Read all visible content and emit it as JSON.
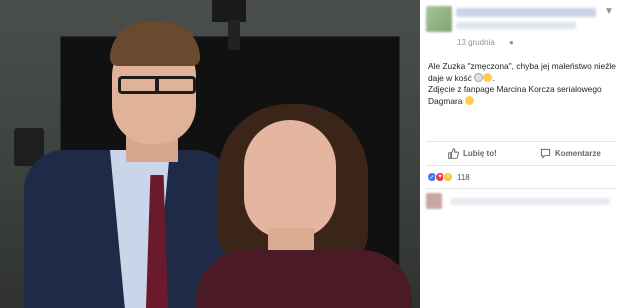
{
  "post": {
    "date": "13 grudnia",
    "privacy_icon": "globe-icon",
    "options_icon": "chevron-down-icon",
    "text": {
      "line1": "Ale Zuzka \"zmęczona\", chyba jej maleństwo nieźle",
      "line2a": "daje w kość",
      "line2b": ".",
      "line3": "Zdjęcie z fanpage Marcina Korcza serialowego",
      "line4": "Dagmara"
    }
  },
  "actions": {
    "like_label": "Lubię to!",
    "comment_label": "Komentarze"
  },
  "reactions": {
    "count": "118",
    "types": [
      "like",
      "love",
      "wow"
    ]
  },
  "colors": {
    "link_blue": "#365899",
    "secondary_text": "#90949c",
    "action_text": "#606770",
    "like_blue": "#3b7bf0",
    "love_red": "#f0344f",
    "wow_yellow": "#f7c13a"
  }
}
